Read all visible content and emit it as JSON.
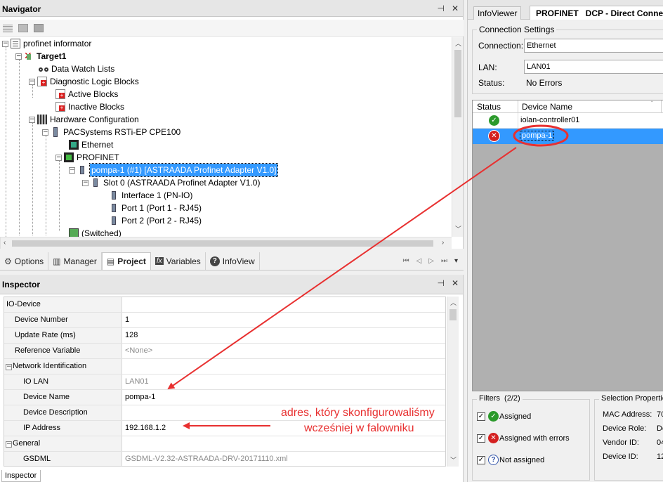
{
  "navigator": {
    "title": "Navigator",
    "tree": [
      {
        "label": "profinet informator"
      },
      {
        "label": "Target1"
      },
      {
        "label": "Data Watch Lists"
      },
      {
        "label": "Diagnostic Logic Blocks"
      },
      {
        "label": "Active Blocks"
      },
      {
        "label": "Inactive Blocks"
      },
      {
        "label": "Hardware Configuration"
      },
      {
        "label": "PACSystems RSTi-EP CPE100"
      },
      {
        "label": "Ethernet"
      },
      {
        "label": "PROFINET"
      },
      {
        "label": "pompa-1 (#1) [ASTRAADA Profinet Adapter V1.0]"
      },
      {
        "label": "Slot   0 (ASTRAADA Profinet Adapter V1.0)"
      },
      {
        "label": "Interface   1 (PN-IO)"
      },
      {
        "label": "Port   1 (Port 1 - RJ45)"
      },
      {
        "label": "Port   2 (Port 2 - RJ45)"
      },
      {
        "label": "(Switched)"
      }
    ],
    "tabs": [
      {
        "label": "Options",
        "icon": "gear-icon"
      },
      {
        "label": "Manager",
        "icon": "books-icon"
      },
      {
        "label": "Project",
        "icon": "project-icon"
      },
      {
        "label": "Variables",
        "icon": "fx-icon"
      },
      {
        "label": "InfoView",
        "icon": "help-icon"
      }
    ]
  },
  "inspector": {
    "title": "Inspector",
    "rows": [
      {
        "name": "IO-Device",
        "value": ""
      },
      {
        "name": "Device Number",
        "value": "1"
      },
      {
        "name": "Update Rate (ms)",
        "value": "128"
      },
      {
        "name": "Reference Variable",
        "value": "<None>"
      },
      {
        "name": "Network Identification",
        "value": ""
      },
      {
        "name": "IO LAN",
        "value": "LAN01"
      },
      {
        "name": "Device Name",
        "value": "pompa-1"
      },
      {
        "name": "Device Description",
        "value": ""
      },
      {
        "name": "IP Address",
        "value": "192.168.1.2"
      },
      {
        "name": "General",
        "value": ""
      },
      {
        "name": "GSDML",
        "value": "GSDML-V2.32-ASTRAADA-DRV-20171110.xml"
      }
    ],
    "bottom_tab": "Inspector"
  },
  "annotation": {
    "line1": "adres, który skonfigurowaliśmy",
    "line2": "wcześniej w falowniku",
    "color": "#e83030"
  },
  "right_panel": {
    "tab_infoviewer": "InfoViewer",
    "tab_profinet": "PROFINET   DCP - Direct Connect",
    "connection_settings": "Connection Settings",
    "connection_label": "Connection:",
    "connection_value": "Ethernet",
    "lan_label": "LAN:",
    "lan_value": "LAN01",
    "status_label": "Status:",
    "status_value": "No Errors",
    "columns": [
      "Status",
      "Device Name"
    ],
    "devices": [
      {
        "status": "ok",
        "name": "iolan-controller01"
      },
      {
        "status": "error",
        "name": "pompa-1"
      }
    ],
    "filters_title": "Filters  (2/2)",
    "filters": [
      "Assigned",
      "Assigned with errors",
      "Not assigned"
    ],
    "selection_title": "Selection Properties",
    "selection_labels": [
      "MAC Address:",
      "Device Role:",
      "Vendor ID:",
      "Device ID:"
    ],
    "selection_values": [
      "70",
      "De",
      "04",
      "12"
    ]
  }
}
